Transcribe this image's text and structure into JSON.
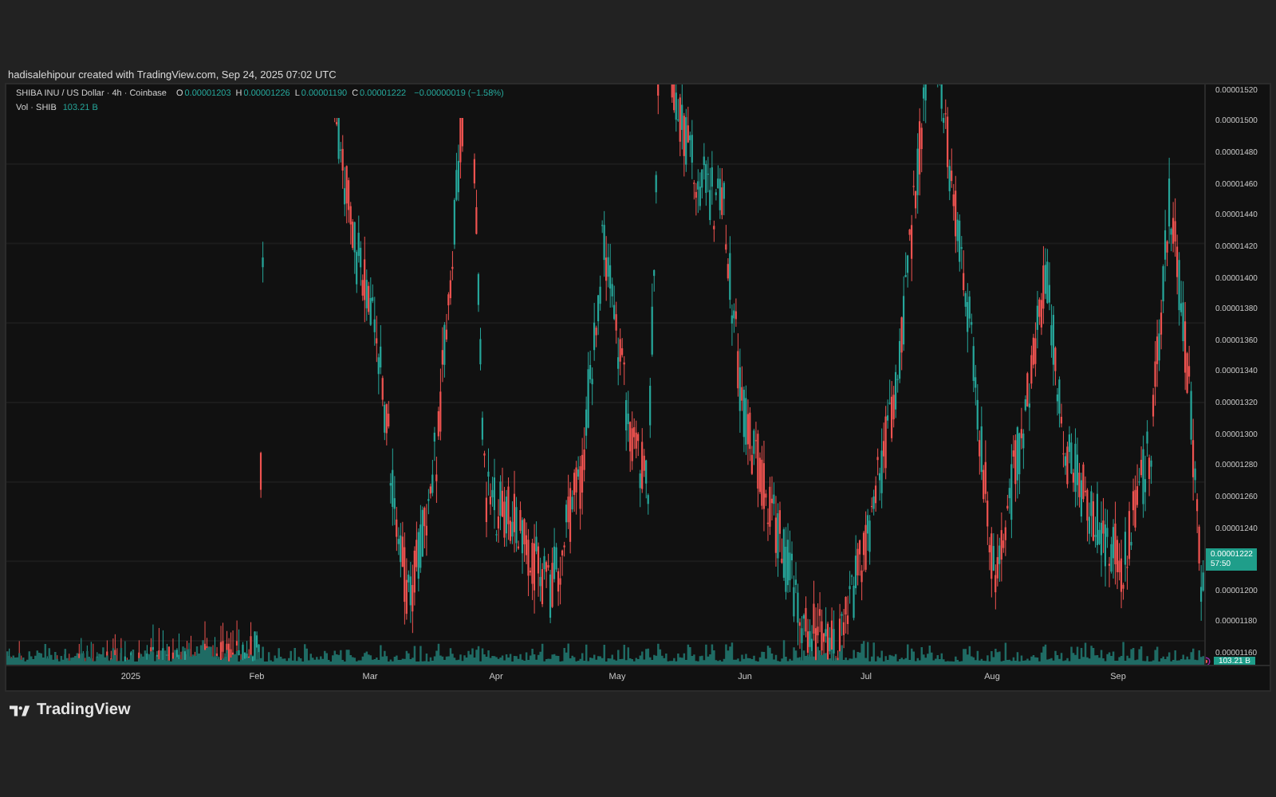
{
  "caption": "hadisalehipour created with TradingView.com, Sep 24, 2025 07:02 UTC",
  "legend": {
    "title": "SHIBA INU / US Dollar · 4h · Coinbase",
    "ohlc": [
      {
        "label": "O",
        "value": "0.00001203"
      },
      {
        "label": "H",
        "value": "0.00001226"
      },
      {
        "label": "L",
        "value": "0.00001190"
      },
      {
        "label": "C",
        "value": "0.00001222"
      }
    ],
    "change": "−0.00000019 (−1.58%)",
    "volume_label": "Vol · SHIB",
    "volume_value": "103.21 B"
  },
  "price_axis": [
    {
      "kind": "label",
      "text": "0.00001520"
    },
    {
      "kind": "label",
      "text": "0.00001500"
    },
    {
      "kind": "label",
      "text": "0.00001480"
    },
    {
      "kind": "label",
      "text": "0.00001460"
    },
    {
      "kind": "label",
      "text": "0.00001440"
    },
    {
      "kind": "label",
      "text": "0.00001420"
    },
    {
      "kind": "label",
      "text": "0.00001400"
    },
    {
      "kind": "label",
      "text": "0.00001380"
    },
    {
      "kind": "label",
      "text": "0.00001360"
    },
    {
      "kind": "label",
      "text": "0.00001340"
    },
    {
      "kind": "label",
      "text": "0.00001320"
    },
    {
      "kind": "label",
      "text": "0.00001300"
    },
    {
      "kind": "label",
      "text": "0.00001280"
    },
    {
      "kind": "label",
      "text": "0.00001260"
    },
    {
      "kind": "label",
      "text": "0.00001240"
    },
    {
      "kind": "price_tag",
      "price": "0.00001222",
      "countdown": "57:50"
    },
    {
      "kind": "label",
      "text": "0.00001200"
    },
    {
      "kind": "label",
      "text": "0.00001180"
    },
    {
      "kind": "label",
      "text": "0.00001160"
    }
  ],
  "volume_tag": "103.21 B",
  "time_axis": [
    "2025",
    "Feb",
    "Mar",
    "Apr",
    "May",
    "Jun",
    "Jul",
    "Aug",
    "Sep"
  ],
  "brand": "TradingView"
}
